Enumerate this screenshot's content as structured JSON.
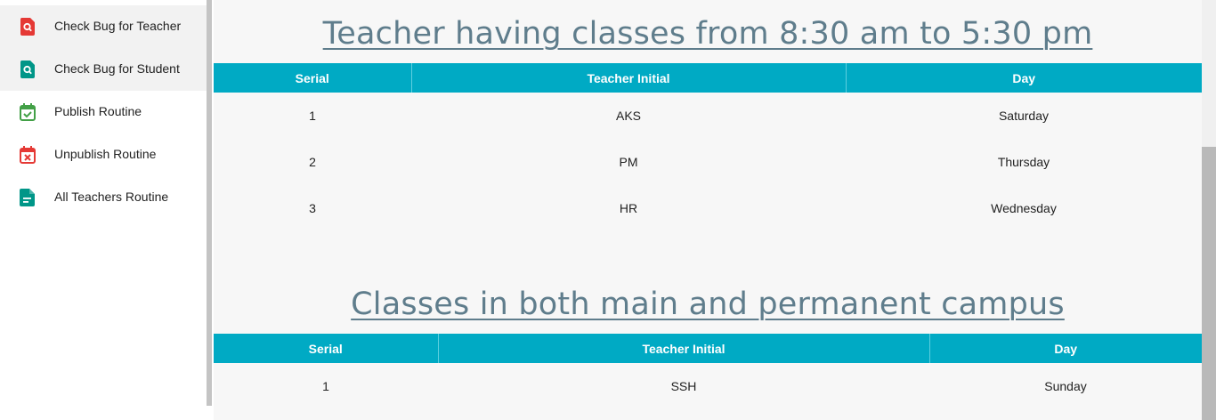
{
  "sidebar": {
    "items": [
      {
        "label": "Check Bug for Teacher",
        "icon": "search-document-icon",
        "color": "#e53935",
        "active": true
      },
      {
        "label": "Check Bug for Student",
        "icon": "search-document-icon",
        "color": "#009688",
        "active": true
      },
      {
        "label": "Publish Routine",
        "icon": "calendar-check-icon",
        "color": "#43a047",
        "active": false
      },
      {
        "label": "Unpublish Routine",
        "icon": "calendar-x-icon",
        "color": "#e53935",
        "active": false
      },
      {
        "label": "All Teachers Routine",
        "icon": "document-icon",
        "color": "#009688",
        "active": false
      }
    ]
  },
  "main": {
    "section1": {
      "title": "Teacher having classes from 8:30 am to 5:30 pm",
      "headers": [
        "Serial",
        "Teacher Initial",
        "Day"
      ],
      "rows": [
        [
          "1",
          "AKS",
          "Saturday"
        ],
        [
          "2",
          "PM",
          "Thursday"
        ],
        [
          "3",
          "HR",
          "Wednesday"
        ]
      ]
    },
    "section2": {
      "title": "Classes in both main and permanent campus",
      "headers": [
        "Serial",
        "Teacher Initial",
        "Day"
      ],
      "rows": [
        [
          "1",
          "SSH",
          "Sunday"
        ]
      ]
    }
  },
  "colors": {
    "table_header": "#00aac4",
    "title": "#5f7d8c"
  }
}
